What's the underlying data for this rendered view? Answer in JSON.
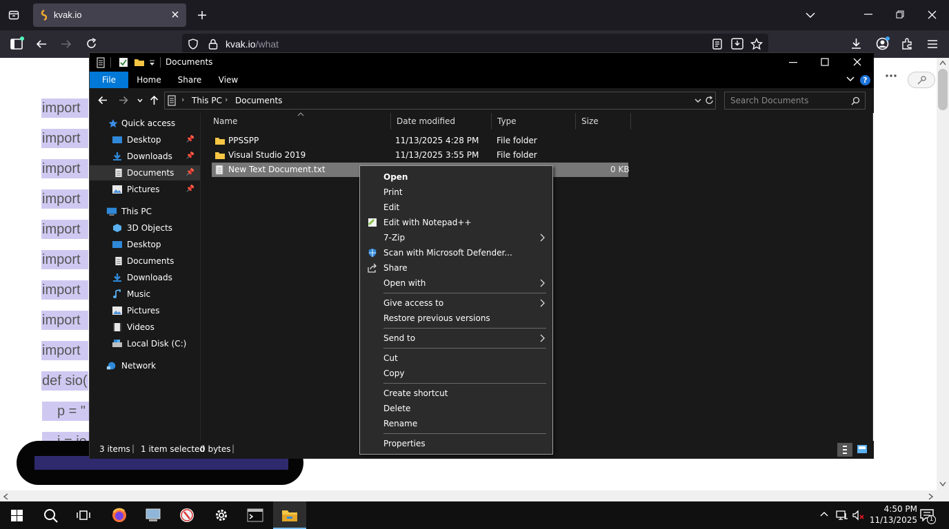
{
  "browser": {
    "tab_title": "kvak.io",
    "url_host": "kvak.io",
    "url_path": "/what"
  },
  "page": {
    "code_lines": [
      "import",
      "import",
      "import",
      "import",
      "import",
      "import",
      "import",
      "import",
      "import",
      "def sio(",
      "p = \"",
      "i = io"
    ]
  },
  "explorer": {
    "title": "Documents",
    "ribbon_tabs": [
      "File",
      "Home",
      "Share",
      "View"
    ],
    "breadcrumb": [
      "This PC",
      "Documents"
    ],
    "search_placeholder": "Search Documents",
    "columns": [
      "Name",
      "Date modified",
      "Type",
      "Size"
    ],
    "nav": {
      "quick_access": "Quick access",
      "quick_items": [
        "Desktop",
        "Downloads",
        "Documents",
        "Pictures"
      ],
      "this_pc": "This PC",
      "pc_items": [
        "3D Objects",
        "Desktop",
        "Documents",
        "Downloads",
        "Music",
        "Pictures",
        "Videos",
        "Local Disk (C:)"
      ],
      "network": "Network"
    },
    "files": [
      {
        "name": "PPSSPP",
        "date": "11/13/2025 4:28 PM",
        "type": "File folder",
        "size": ""
      },
      {
        "name": "Visual Studio 2019",
        "date": "11/13/2025 3:55 PM",
        "type": "File folder",
        "size": ""
      },
      {
        "name": "New Text Document.txt",
        "date": "",
        "type": "",
        "size": "0 KB"
      }
    ],
    "status": {
      "items": "3 items",
      "selected": "1 item selected",
      "size": "0 bytes"
    }
  },
  "context_menu": {
    "items": {
      "open": "Open",
      "print": "Print",
      "edit": "Edit",
      "edit_notepad": "Edit with Notepad++",
      "zip": "7-Zip",
      "scan": "Scan with Microsoft Defender...",
      "share": "Share",
      "open_with": "Open with",
      "give_access": "Give access to",
      "restore": "Restore previous versions",
      "send_to": "Send to",
      "cut": "Cut",
      "copy": "Copy",
      "create_shortcut": "Create shortcut",
      "delete": "Delete",
      "rename": "Rename",
      "properties": "Properties"
    }
  },
  "taskbar": {
    "time": "4:50 PM",
    "date": "11/13/2025",
    "notification_count": "1"
  },
  "colors": {
    "accent": "#0078d7",
    "highlight": "#cfc9f2",
    "menu_bg": "#2b2b2b"
  }
}
